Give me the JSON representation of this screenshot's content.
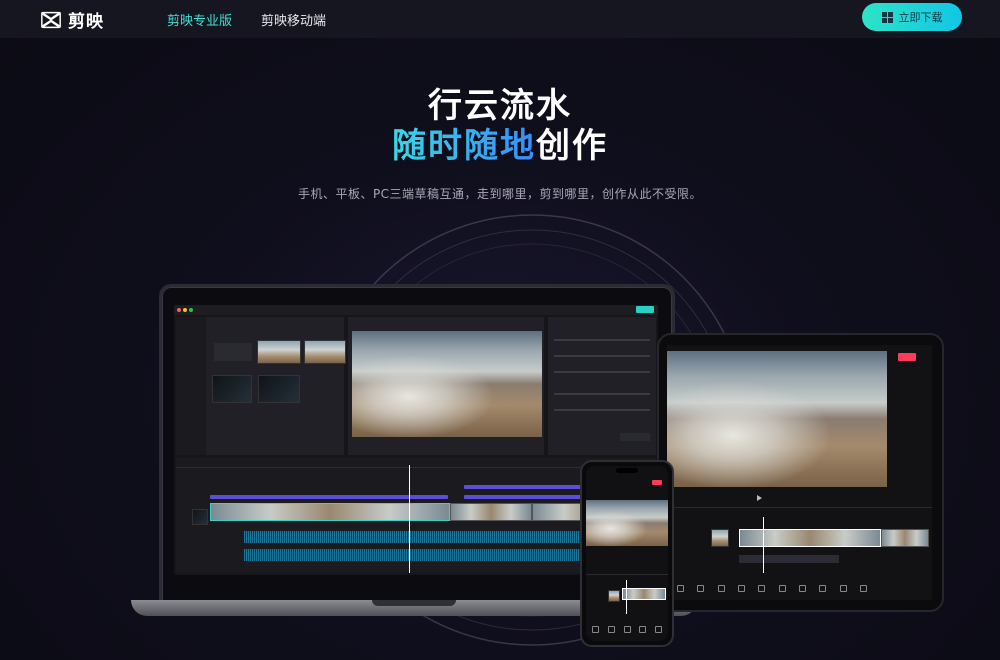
{
  "brand": {
    "name": "剪映"
  },
  "nav": {
    "items": [
      {
        "label": "剪映专业版",
        "active": true
      },
      {
        "label": "剪映移动端",
        "active": false
      }
    ],
    "download_label": "立即下载"
  },
  "hero": {
    "line1": "行云流水",
    "line2_highlight": "随时随地",
    "line2_rest": "创作",
    "subtitle": "手机、平板、PC三端草稿互通，走到哪里，剪到哪里，创作从此不受限。"
  },
  "colors": {
    "accent": "#3ce0d6",
    "button_gradient": [
      "#2de3c7",
      "#12c6e6"
    ],
    "headline_gradient": [
      "#3ad7e6",
      "#3a8cf6"
    ],
    "background": "#0d0d18",
    "nav_bg": "#15161f"
  },
  "icons": [
    "capcut-logo-icon",
    "windows-icon"
  ]
}
